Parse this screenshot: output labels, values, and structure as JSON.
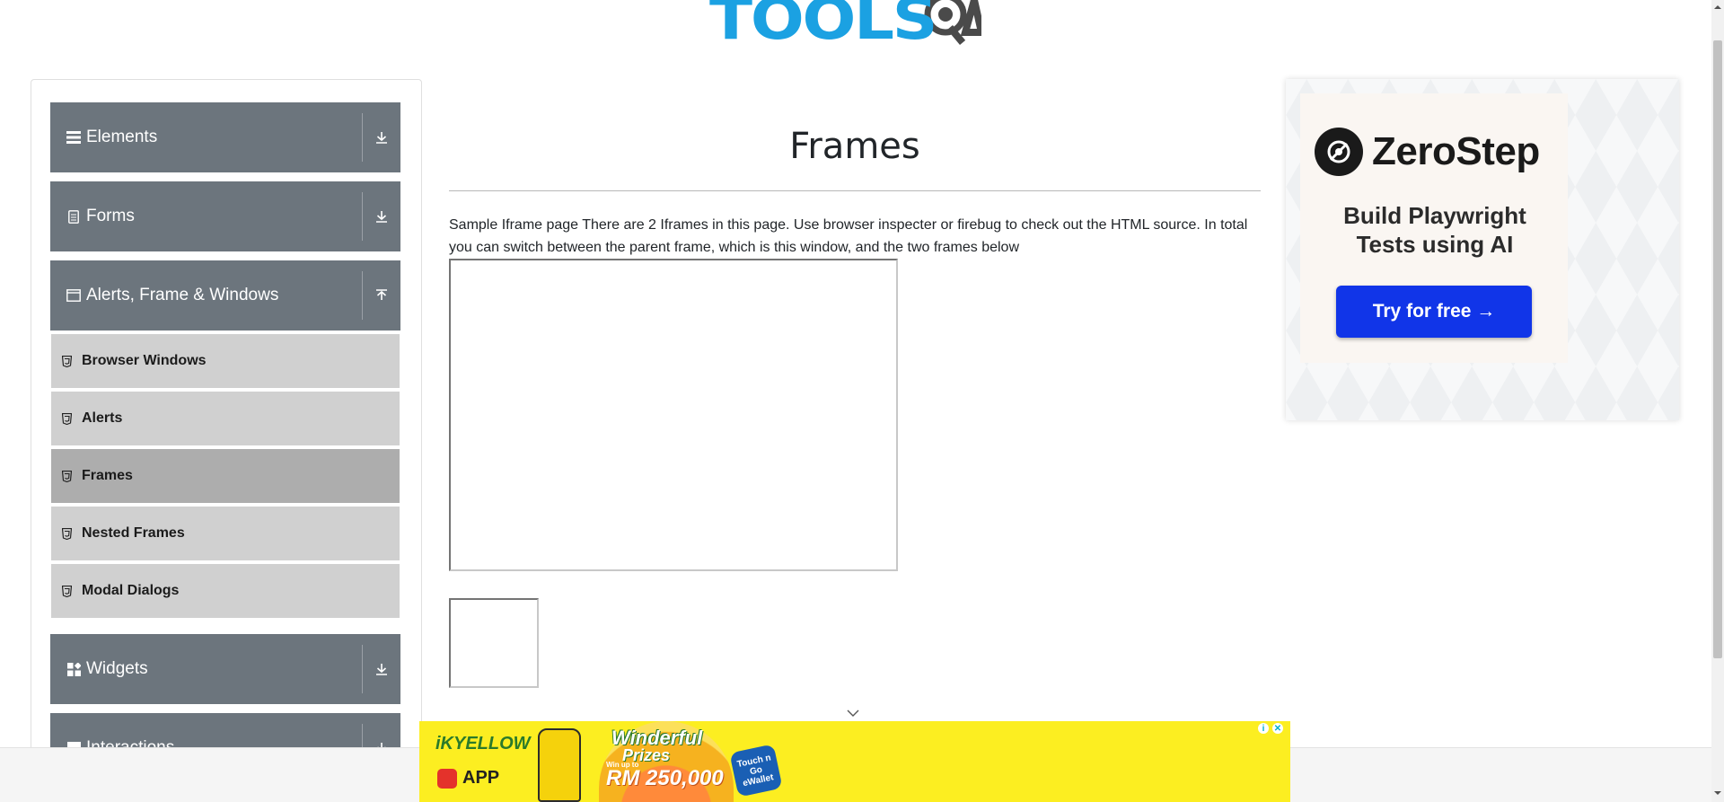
{
  "header": {
    "logo_text_1": "TOOLS",
    "logo_text_2": "QA"
  },
  "sidebar": {
    "groups": [
      {
        "label": "Elements",
        "icon": "menu-icon",
        "state": "collapsed"
      },
      {
        "label": "Forms",
        "icon": "form-icon",
        "state": "collapsed"
      },
      {
        "label": "Alerts, Frame & Windows",
        "icon": "window-icon",
        "state": "expanded"
      },
      {
        "label": "Widgets",
        "icon": "widgets-icon",
        "state": "collapsed"
      },
      {
        "label": "Interactions",
        "icon": "interactions-icon",
        "state": "collapsed"
      }
    ],
    "items": [
      {
        "label": "Browser Windows"
      },
      {
        "label": "Alerts"
      },
      {
        "label": "Frames",
        "active": true
      },
      {
        "label": "Nested Frames"
      },
      {
        "label": "Modal Dialogs"
      }
    ]
  },
  "main": {
    "title": "Frames",
    "description": "Sample Iframe page There are 2 Iframes in this page. Use browser inspecter or firebug to check out the HTML source. In total you can switch between the parent frame, which is this window, and the two frames below"
  },
  "ad_right": {
    "brand": "ZeroStep",
    "tagline_1": "Build Playwright",
    "tagline_2": "Tests using AI",
    "button": "Try for free →"
  },
  "ad_bottom": {
    "brand": "YELLOW",
    "brand_prefix": "iK",
    "app": "APP",
    "prize_title_1": "Winderful",
    "prize_title_2": "Prizes",
    "prize_sub": "Win up to",
    "prize_amount": "RM 250,000",
    "wallet": "Touch n Go eWallet"
  },
  "colors": {
    "sidebar_group": "#6c757d",
    "sidebar_item": "#d0d0d0",
    "sidebar_item_active": "#adadad",
    "logo_blue": "#1ba1e2",
    "cta_blue": "#1135e8",
    "ad_yellow": "#fcee21"
  }
}
